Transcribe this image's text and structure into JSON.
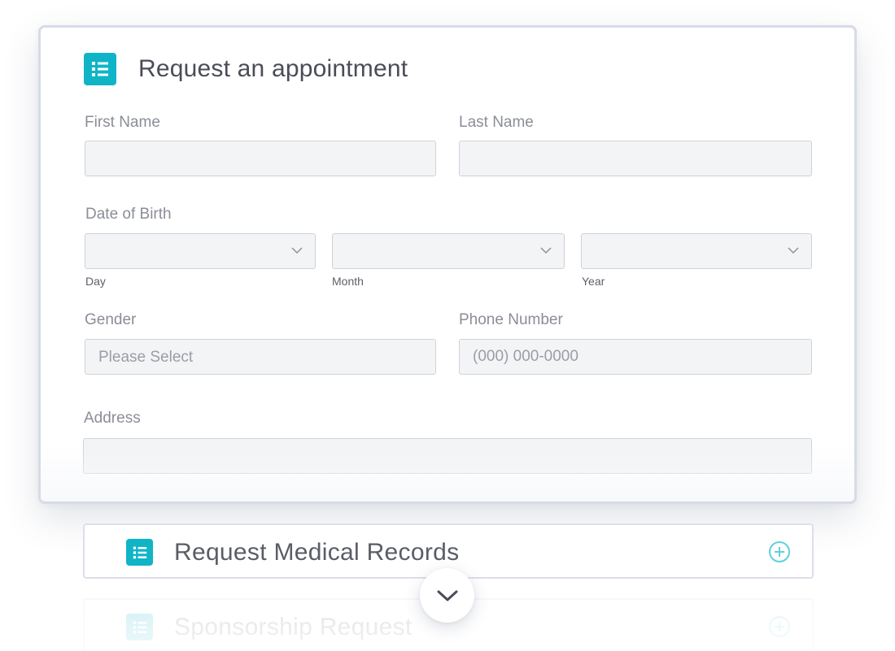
{
  "form": {
    "title": "Request an appointment",
    "icon": "form-list-icon",
    "accent_color": "#0fb4c7",
    "first_name": {
      "label": "First Name",
      "value": ""
    },
    "last_name": {
      "label": "Last Name",
      "value": ""
    },
    "dob": {
      "label": "Date of Birth",
      "day": {
        "sublabel": "Day",
        "value": ""
      },
      "month": {
        "sublabel": "Month",
        "value": ""
      },
      "year": {
        "sublabel": "Year",
        "value": ""
      }
    },
    "gender": {
      "label": "Gender",
      "value": "Please Select"
    },
    "phone": {
      "label": "Phone Number",
      "placeholder": "(000) 000-0000"
    },
    "address": {
      "label": "Address",
      "value": ""
    }
  },
  "collapsed_forms": [
    {
      "title": "Request Medical Records",
      "icon": "form-list-icon",
      "action_icon": "plus-circle-icon"
    },
    {
      "title": "Sponsorship Request",
      "icon": "form-list-icon",
      "action_icon": "plus-circle-icon"
    }
  ],
  "scroll_button": {
    "icon": "chevron-down-icon"
  }
}
